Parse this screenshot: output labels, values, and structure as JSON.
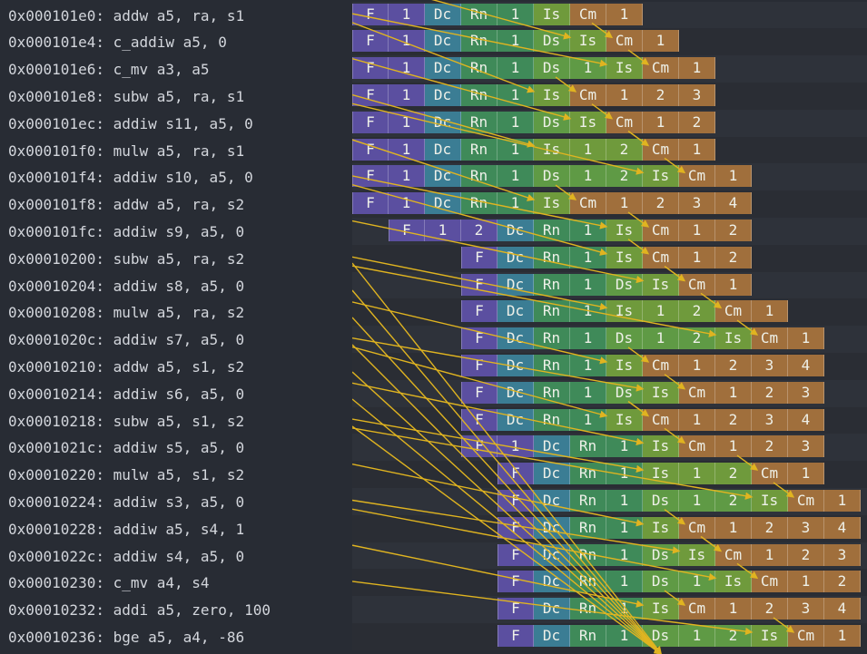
{
  "rows": [
    {
      "addr": "0x000101e0",
      "asm": "addw a5, ra, s1",
      "start": 0,
      "cells": [
        "F",
        "1",
        "Dc",
        "Rn",
        "1",
        "Is",
        "Cm",
        "1"
      ]
    },
    {
      "addr": "0x000101e4",
      "asm": "c_addiw a5, 0",
      "start": 0,
      "cells": [
        "F",
        "1",
        "Dc",
        "Rn",
        "1",
        "Ds",
        "Is",
        "Cm",
        "1"
      ]
    },
    {
      "addr": "0x000101e6",
      "asm": "c_mv a3, a5",
      "start": 0,
      "cells": [
        "F",
        "1",
        "Dc",
        "Rn",
        "1",
        "Ds",
        "1",
        "Is",
        "Cm",
        "1"
      ]
    },
    {
      "addr": "0x000101e8",
      "asm": "subw a5, ra, s1",
      "start": 0,
      "cells": [
        "F",
        "1",
        "Dc",
        "Rn",
        "1",
        "Is",
        "Cm",
        "1",
        "2",
        "3"
      ]
    },
    {
      "addr": "0x000101ec",
      "asm": "addiw s11, a5, 0",
      "start": 0,
      "cells": [
        "F",
        "1",
        "Dc",
        "Rn",
        "1",
        "Ds",
        "Is",
        "Cm",
        "1",
        "2"
      ]
    },
    {
      "addr": "0x000101f0",
      "asm": "mulw a5, ra, s1",
      "start": 0,
      "cells": [
        "F",
        "1",
        "Dc",
        "Rn",
        "1",
        "Is",
        "1",
        "2",
        "Cm",
        "1"
      ]
    },
    {
      "addr": "0x000101f4",
      "asm": "addiw s10, a5, 0",
      "start": 0,
      "cells": [
        "F",
        "1",
        "Dc",
        "Rn",
        "1",
        "Ds",
        "1",
        "2",
        "Is",
        "Cm",
        "1"
      ]
    },
    {
      "addr": "0x000101f8",
      "asm": "addw a5, ra, s2",
      "start": 0,
      "cells": [
        "F",
        "1",
        "Dc",
        "Rn",
        "1",
        "Is",
        "Cm",
        "1",
        "2",
        "3",
        "4"
      ]
    },
    {
      "addr": "0x000101fc",
      "asm": "addiw s9, a5, 0",
      "start": 1,
      "cells": [
        "F",
        "1",
        "2",
        "Dc",
        "Rn",
        "1",
        "Is",
        "Cm",
        "1",
        "2"
      ]
    },
    {
      "addr": "0x00010200",
      "asm": "subw a5, ra, s2",
      "start": 3,
      "cells": [
        "F",
        "Dc",
        "Rn",
        "1",
        "Is",
        "Cm",
        "1",
        "2"
      ]
    },
    {
      "addr": "0x00010204",
      "asm": "addiw s8, a5, 0",
      "start": 3,
      "cells": [
        "F",
        "Dc",
        "Rn",
        "1",
        "Ds",
        "Is",
        "Cm",
        "1"
      ]
    },
    {
      "addr": "0x00010208",
      "asm": "mulw a5, ra, s2",
      "start": 3,
      "cells": [
        "F",
        "Dc",
        "Rn",
        "1",
        "Is",
        "1",
        "2",
        "Cm",
        "1"
      ]
    },
    {
      "addr": "0x0001020c",
      "asm": "addiw s7, a5, 0",
      "start": 3,
      "cells": [
        "F",
        "Dc",
        "Rn",
        "1",
        "Ds",
        "1",
        "2",
        "Is",
        "Cm",
        "1"
      ]
    },
    {
      "addr": "0x00010210",
      "asm": "addw a5, s1, s2",
      "start": 3,
      "cells": [
        "F",
        "Dc",
        "Rn",
        "1",
        "Is",
        "Cm",
        "1",
        "2",
        "3",
        "4"
      ]
    },
    {
      "addr": "0x00010214",
      "asm": "addiw s6, a5, 0",
      "start": 3,
      "cells": [
        "F",
        "Dc",
        "Rn",
        "1",
        "Ds",
        "Is",
        "Cm",
        "1",
        "2",
        "3"
      ]
    },
    {
      "addr": "0x00010218",
      "asm": "subw a5, s1, s2",
      "start": 3,
      "cells": [
        "F",
        "Dc",
        "Rn",
        "1",
        "Is",
        "Cm",
        "1",
        "2",
        "3",
        "4"
      ]
    },
    {
      "addr": "0x0001021c",
      "asm": "addiw s5, a5, 0",
      "start": 3,
      "cells": [
        "F",
        "1",
        "Dc",
        "Rn",
        "1",
        "Is",
        "Cm",
        "1",
        "2",
        "3"
      ]
    },
    {
      "addr": "0x00010220",
      "asm": "mulw a5, s1, s2",
      "start": 4,
      "cells": [
        "F",
        "Dc",
        "Rn",
        "1",
        "Is",
        "1",
        "2",
        "Cm",
        "1"
      ]
    },
    {
      "addr": "0x00010224",
      "asm": "addiw s3, a5, 0",
      "start": 4,
      "cells": [
        "F",
        "Dc",
        "Rn",
        "1",
        "Ds",
        "1",
        "2",
        "Is",
        "Cm",
        "1"
      ]
    },
    {
      "addr": "0x00010228",
      "asm": "addiw a5, s4, 1",
      "start": 4,
      "cells": [
        "F",
        "Dc",
        "Rn",
        "1",
        "Is",
        "Cm",
        "1",
        "2",
        "3",
        "4"
      ]
    },
    {
      "addr": "0x0001022c",
      "asm": "addiw s4, a5, 0",
      "start": 4,
      "cells": [
        "F",
        "Dc",
        "Rn",
        "1",
        "Ds",
        "Is",
        "Cm",
        "1",
        "2",
        "3"
      ]
    },
    {
      "addr": "0x00010230",
      "asm": "c_mv a4, s4",
      "start": 4,
      "cells": [
        "F",
        "Dc",
        "Rn",
        "1",
        "Ds",
        "1",
        "Is",
        "Cm",
        "1",
        "2"
      ]
    },
    {
      "addr": "0x00010232",
      "asm": "addi a5, zero, 100",
      "start": 4,
      "cells": [
        "F",
        "Dc",
        "Rn",
        "1",
        "Is",
        "Cm",
        "1",
        "2",
        "3",
        "4"
      ]
    },
    {
      "addr": "0x00010236",
      "asm": "bge a5, a4, -86",
      "start": 4,
      "cells": [
        "F",
        "Dc",
        "Rn",
        "1",
        "Ds",
        "1",
        "2",
        "Is",
        "Cm",
        "1"
      ]
    }
  ],
  "colors": {
    "F": "#5b4fa0",
    "Dc": "#3b7d94",
    "Rn": "#3f8a59",
    "Ds": "#5f9a45",
    "Is": "#6f9a3c",
    "Cm": "#a06f3c",
    "arrow": "#e0b420",
    "row_even": "#2e323a",
    "row_odd": "#2a2d34"
  },
  "icons": {
    "dependency": "arrow-icon"
  }
}
